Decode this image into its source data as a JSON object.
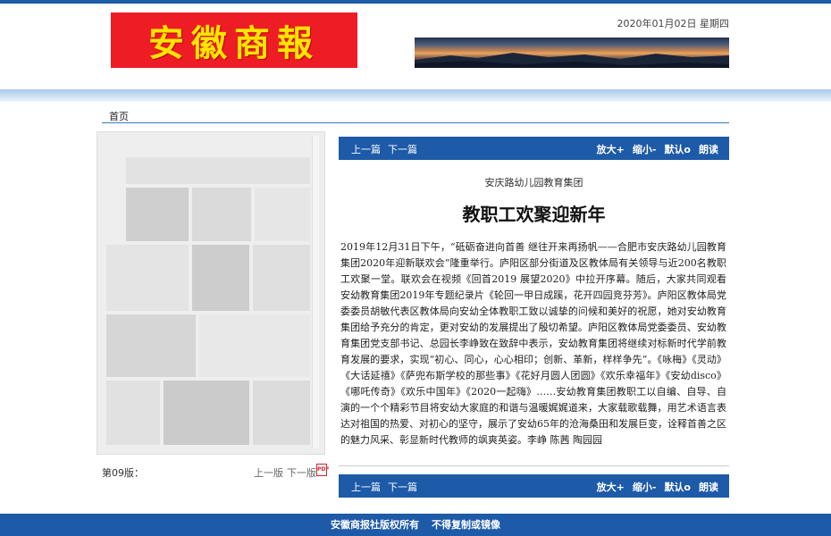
{
  "header": {
    "logo_text": "安徽商報",
    "date": "2020年01月02日 星期四"
  },
  "breadcrumb": {
    "home": "首页"
  },
  "page_nav": {
    "page_label": "第09版：",
    "prev": "上一版",
    "next": "下一版",
    "pdf_icon": "pdf-icon"
  },
  "toolbar": {
    "prev_article": "上一篇",
    "next_article": "下一篇",
    "zoom_in": "放大+",
    "zoom_out": "缩小-",
    "default": "默认o",
    "read_aloud": "朗读"
  },
  "article": {
    "subtitle": "安庆路幼儿园教育集团",
    "title": "教职工欢聚迎新年",
    "body": "2019年12月31日下午，“砥砺奋进向首善 继往开来再扬帆——合肥市安庆路幼儿园教育集团2020年迎新联欢会”隆重举行。庐阳区部分街道及区教体局有关领导与近200名教职工欢聚一堂。联欢会在视频《回首2019 展望2020》中拉开序幕。随后，大家共同观看安幼教育集团2019年专题纪录片《轮回一甲日成蹊，花开四园竞芬芳》。庐阳区教体局党委委员胡敏代表区教体局向安幼全体教职工致以诚挚的问候和美好的祝愿，她对安幼教育集团给予充分的肯定，更对安幼的发展提出了殷切希望。庐阳区教体局党委委员、安幼教育集团党支部书记、总园长李峥致在致辞中表示，安幼教育集团将继续对标新时代学前教育发展的要求，实现“初心、同心，心心相印；创新、革新，样样争先”。《咏梅》《灵动》《大话延禧》《萨兜布斯学校的那些事》《花好月圆人团圆》《欢乐幸福年》《安幼disco》《哪吒传奇》《欢乐中国年》《2020一起嗨》……安幼教育集团教职工以自编、自导、自演的一个个精彩节目将安幼大家庭的和谐与温暖娓娓道来，大家载歌载舞，用艺术语言表达对祖国的热爱、对初心的坚守，展示了安幼65年的沧海桑田和发展巨变，诠释首善之区的魅力风采、彰显新时代教师的飒爽英姿。李峥 陈茜 陶园园"
  },
  "footer": {
    "copyright": "安徽商报社版权所有",
    "notice": "不得复制或镜像"
  },
  "colors": {
    "brand_blue": "#1d5aa8",
    "logo_red": "#ee1c25",
    "logo_yellow": "#ffe400"
  }
}
